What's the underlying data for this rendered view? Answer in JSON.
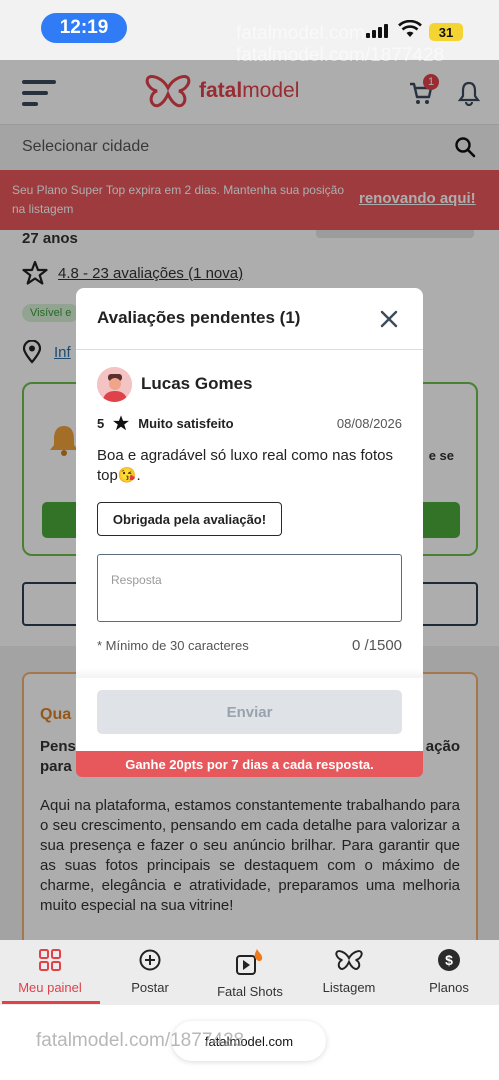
{
  "status_bar": {
    "time": "12:19",
    "battery": "31"
  },
  "watermark": {
    "line1": "fatalmodel.com",
    "line2": "fatalmodel.com/1877428",
    "bottom": "fatalmodel.com/1877428"
  },
  "header": {
    "logo_text_bold": "fatal",
    "logo_text_light": "model",
    "cart_count": "1"
  },
  "search": {
    "placeholder": "Selecionar cidade"
  },
  "banner": {
    "text": "Seu Plano Super Top expira em 2 dias. Mantenha sua posição na listagem",
    "link": "renovando aqui!"
  },
  "background": {
    "age": "27 anos",
    "rating": "4.8 - 23 avaliações (1 nova)",
    "visible_badge": "Visível e",
    "info_link": "Inf",
    "green_card_fragment": "e se",
    "orange_title": "Qua",
    "bold_line1": "Pens",
    "bold_line1_right": "ação",
    "bold_line2": "para",
    "paragraph": "Aqui na plataforma, estamos constantemente trabalhando para o seu crescimento, pensando em cada detalhe para valorizar a sua presença e fazer o seu anúncio brilhar. Para garantir que as suas fotos principais se destaquem com o máximo de charme, elegância e atratividade, preparamos uma melhoria muito especial na sua vitrine!"
  },
  "modal": {
    "title": "Avaliações pendentes (1)",
    "reviewer": "Lucas Gomes",
    "score": "5",
    "satisfaction": "Muito satisfeito",
    "date": "08/08/2026",
    "review_text": "Boa e agradável só luxo real como nas fotos top😘.",
    "thanks_button": "Obrigada pela avaliação!",
    "reply_placeholder": "Resposta",
    "min_chars": "* Mínimo de 30 caracteres",
    "counter": "0 /1500",
    "send_button": "Enviar",
    "promo": "Ganhe 20pts por 7 dias a cada resposta."
  },
  "nav": {
    "items": [
      {
        "label": "Meu painel",
        "icon": "dashboard-icon",
        "active": true
      },
      {
        "label": "Postar",
        "icon": "plus-circle-icon",
        "active": false
      },
      {
        "label": "Fatal Shots",
        "icon": "video-fire-icon",
        "active": false
      },
      {
        "label": "Listagem",
        "icon": "butterfly-icon",
        "active": false
      },
      {
        "label": "Planos",
        "icon": "dollar-icon",
        "active": false
      }
    ]
  },
  "url_bar": {
    "domain": "fatalmodel.com"
  },
  "colors": {
    "brand": "#e0424a",
    "banner": "#e7585c",
    "green": "#4caa3a",
    "orange": "#d9822b"
  }
}
